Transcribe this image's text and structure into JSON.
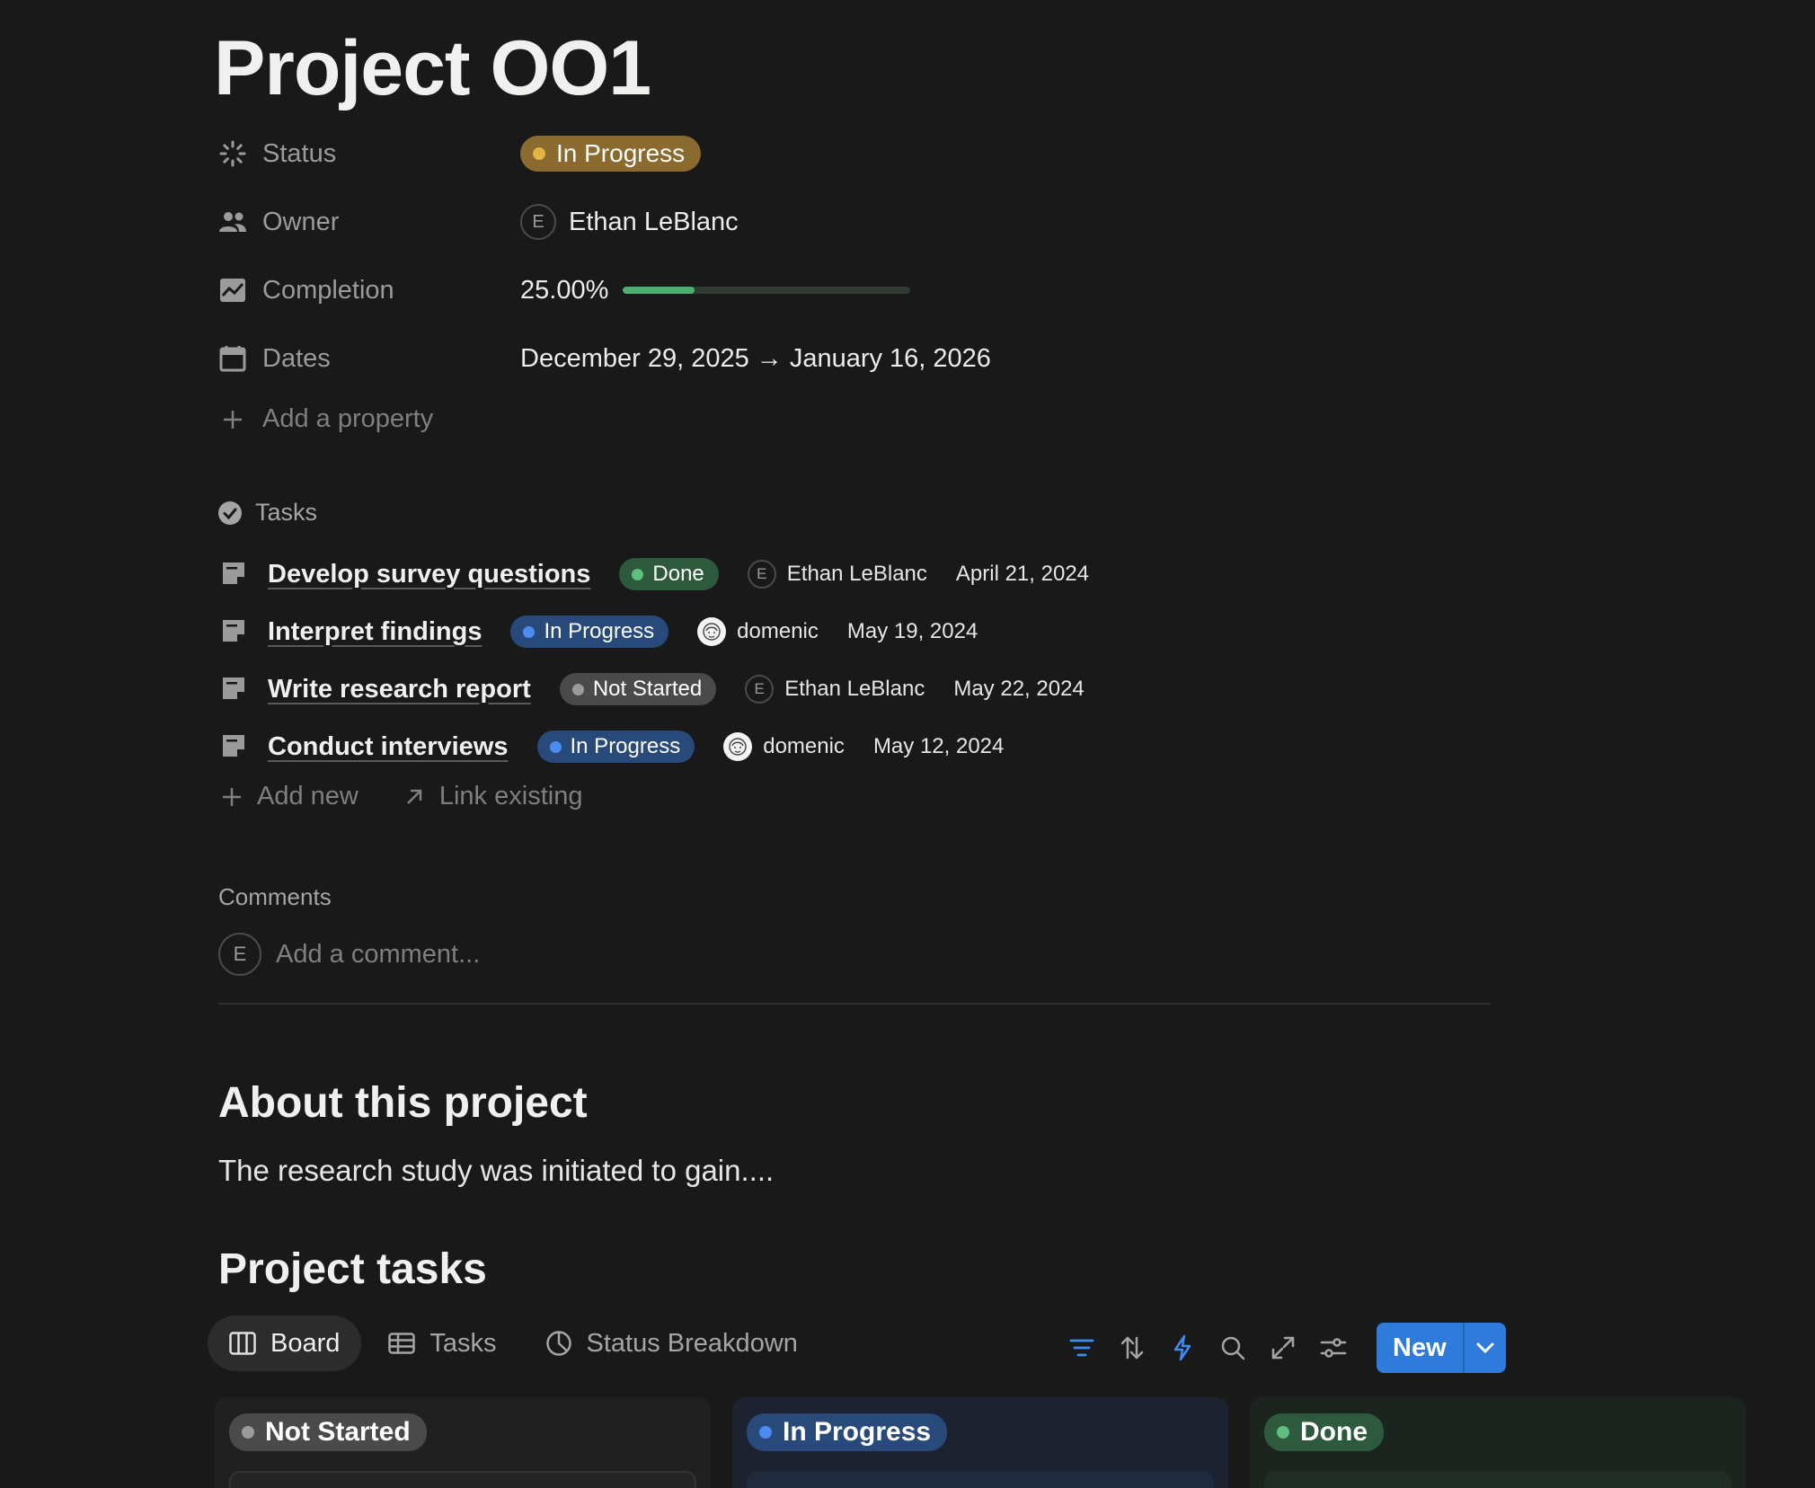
{
  "page_title": "Project OO1",
  "properties": {
    "status": {
      "label": "Status",
      "value": "In Progress",
      "color": "#8a6a2e",
      "dot": "#e3b341"
    },
    "owner": {
      "label": "Owner",
      "avatar_initial": "E",
      "name": "Ethan LeBlanc"
    },
    "completion": {
      "label": "Completion",
      "value_text": "25.00%",
      "fraction": 0.25
    },
    "dates": {
      "label": "Dates",
      "value": "December 29, 2025 → January 16, 2026"
    },
    "add_property": "Add a property"
  },
  "tasks": {
    "heading": "Tasks",
    "items": [
      {
        "title": "Develop survey questions",
        "status": "Done",
        "status_bg": "#2d5a3d",
        "status_dot": "#5fbf7f",
        "assignee": "Ethan LeBlanc",
        "assignee_type": "initial",
        "initial": "E",
        "date": "April 21, 2024"
      },
      {
        "title": "Interpret findings",
        "status": "In Progress",
        "status_bg": "#284a7a",
        "status_dot": "#4b8cf0",
        "assignee": "domenic",
        "assignee_type": "face",
        "date": "May 19, 2024"
      },
      {
        "title": "Write research report",
        "status": "Not Started",
        "status_bg": "#4a4a4a",
        "status_dot": "#9b9b9b",
        "assignee": "Ethan LeBlanc",
        "assignee_type": "initial",
        "initial": "E",
        "date": "May 22, 2024"
      },
      {
        "title": "Conduct interviews",
        "status": "In Progress",
        "status_bg": "#284a7a",
        "status_dot": "#4b8cf0",
        "assignee": "domenic",
        "assignee_type": "face",
        "date": "May 12, 2024"
      }
    ],
    "add_new": "Add new",
    "link_existing": "Link existing"
  },
  "comments": {
    "label": "Comments",
    "avatar_initial": "E",
    "placeholder": "Add a comment..."
  },
  "about": {
    "heading": "About this project",
    "text": "The research study was initiated to gain...."
  },
  "project_tasks": {
    "heading": "Project tasks",
    "tabs": [
      {
        "label": "Board",
        "icon": "board-icon",
        "active": true
      },
      {
        "label": "Tasks",
        "icon": "table-icon",
        "active": false
      },
      {
        "label": "Status Breakdown",
        "icon": "pie-chart-icon",
        "active": false
      }
    ],
    "toolbar": {
      "icons": [
        "filter-icon",
        "sort-icon",
        "automation-icon",
        "search-icon",
        "expand-icon",
        "settings-icon"
      ],
      "new_label": "New"
    },
    "columns": [
      {
        "label": "Not Started",
        "bg": "#202020",
        "pill_bg": "#4a4a4a",
        "dot": "#9b9b9b",
        "card_bg": "#252525"
      },
      {
        "label": "In Progress",
        "bg": "#1c2230",
        "pill_bg": "#284a7a",
        "dot": "#4b8cf0",
        "card_bg": "#1f2a3d"
      },
      {
        "label": "Done",
        "bg": "#1c2420",
        "pill_bg": "#2d5a3d",
        "dot": "#5fbf7f",
        "card_bg": "#1f2d25"
      }
    ]
  },
  "colors": {
    "accent": "#2f7bdb",
    "background": "#191919"
  }
}
